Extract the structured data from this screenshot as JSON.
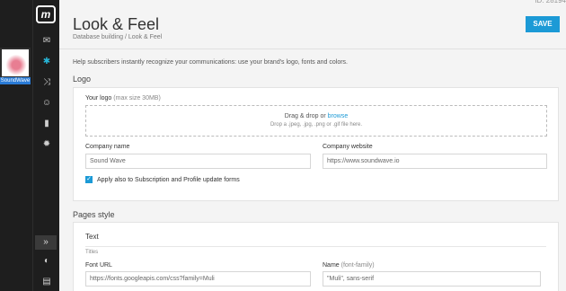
{
  "sidebar": {
    "logo_text": "m",
    "brand_label": "SoundWave",
    "nav_icons": [
      "mail-icon",
      "palette-icon",
      "shuffle-icon",
      "users-icon",
      "chart-icon",
      "settings-icon"
    ],
    "bottom_icons": [
      "expand-icon",
      "help-icon",
      "chat-icon"
    ]
  },
  "topbar": {
    "account_id": "ID: 28194"
  },
  "header": {
    "title": "Look & Feel",
    "breadcrumb": "Database building / Look & Feel",
    "save_label": "SAVE"
  },
  "intro": "Help subscribers instantly recognize your communications: use your brand's logo, fonts and colors.",
  "logo_section": {
    "title": "Logo",
    "your_logo_label": "Your logo",
    "your_logo_hint": "(max size 30MB)",
    "drop_text": "Drag & drop or ",
    "browse_text": "browse",
    "drop_hint": "Drop a .jpeg, .jpg, .png or .gif file here.",
    "company_name_label": "Company name",
    "company_name_value": "Sound Wave",
    "company_website_label": "Company website",
    "company_website_value": "https://www.soundwave.io",
    "apply_label": "Apply also to Subscription and Profile update forms"
  },
  "pages_section": {
    "title": "Pages style",
    "text_head": "Text",
    "titles_label": "Titles",
    "font_url_label": "Font URL",
    "font_url_value": "https://fonts.googleapis.com/css?family=Muli",
    "name_label": "Name",
    "name_hint": "(font-family)",
    "name_value": "\"Muli\", sans-serif"
  }
}
